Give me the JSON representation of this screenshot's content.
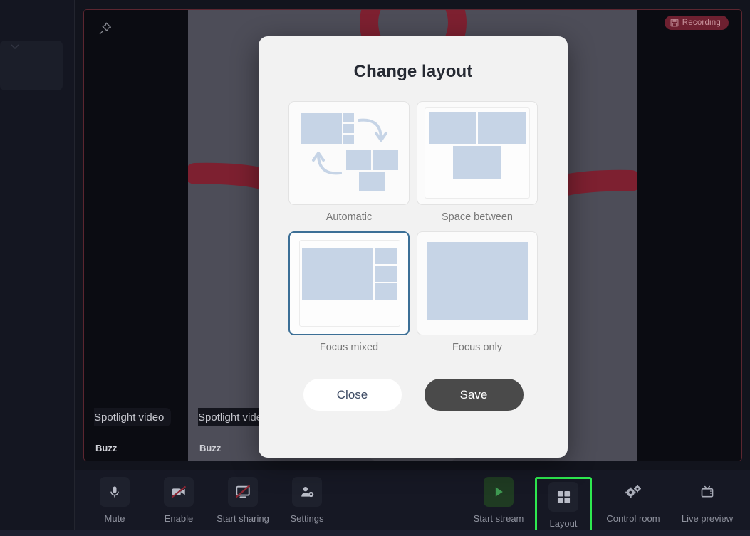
{
  "stage": {
    "pin_icon": "pin-icon",
    "recording_badge": {
      "label": "Recording",
      "icon": "save-disk-icon",
      "color": "#6e2030"
    },
    "tile": {
      "spotlight_label": "Spotlight video",
      "participant_name": "Buzz"
    }
  },
  "modal": {
    "title": "Change layout",
    "options": [
      {
        "id": "automatic",
        "label": "Automatic",
        "selected": false
      },
      {
        "id": "space-between",
        "label": "Space between",
        "selected": false
      },
      {
        "id": "focus-mixed",
        "label": "Focus mixed",
        "selected": true
      },
      {
        "id": "focus-only",
        "label": "Focus only",
        "selected": false
      }
    ],
    "selected_option": "Focus mixed",
    "buttons": {
      "close": "Close",
      "save": "Save"
    },
    "colors": {
      "selected_border": "#3c6f96",
      "block": "#c6d4e6",
      "save_bg": "#4a4a4a",
      "close_text": "#3c4a63"
    }
  },
  "toolbar": {
    "left_items": [
      {
        "label": "Mute",
        "icon": "microphone-icon"
      },
      {
        "label": "Enable",
        "icon": "camera-off-icon"
      },
      {
        "label": "Start sharing",
        "icon": "screen-share-off-icon"
      },
      {
        "label": "Settings",
        "icon": "person-gear-icon"
      }
    ],
    "right_items": [
      {
        "label": "Start stream",
        "icon": "play-icon",
        "accent": "#3f9a52"
      },
      {
        "label": "Layout",
        "icon": "grid-icon",
        "highlighted": true
      },
      {
        "label": "Control room",
        "icon": "gears-icon"
      },
      {
        "label": "Live preview",
        "icon": "tv-icon"
      }
    ],
    "highlight_color": "#2ee84f"
  }
}
